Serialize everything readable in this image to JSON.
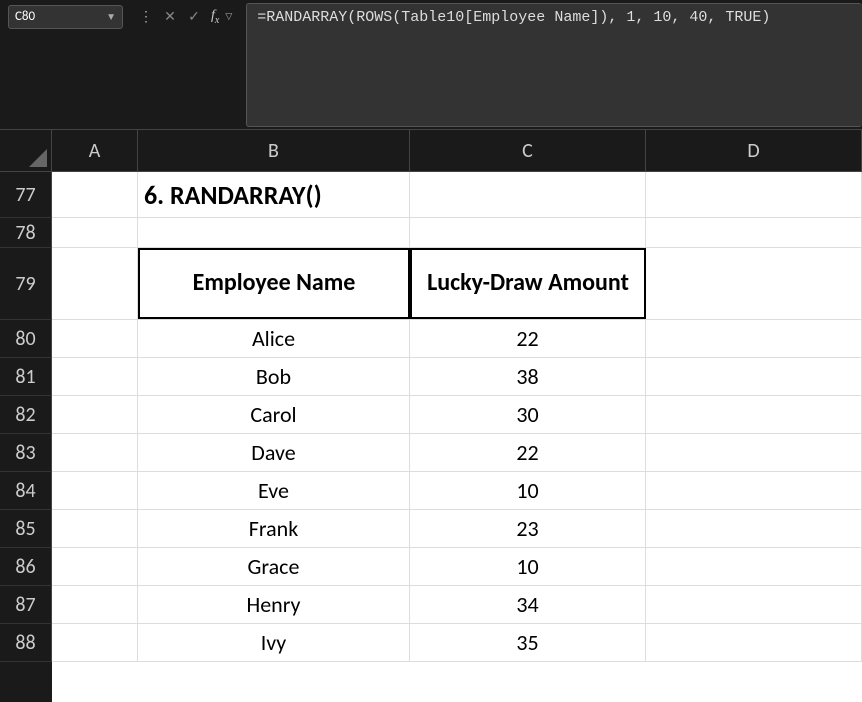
{
  "nameBox": {
    "value": "C80"
  },
  "formulaBar": {
    "formula": "=RANDARRAY(ROWS(Table10[Employee Name]), 1, 10, 40, TRUE)"
  },
  "columns": [
    "A",
    "B",
    "C",
    "D"
  ],
  "rows": [
    "77",
    "78",
    "79",
    "80",
    "81",
    "82",
    "83",
    "84",
    "85",
    "86",
    "87",
    "88"
  ],
  "title": "6. RANDARRAY()",
  "tableHeaders": {
    "employeeName": "Employee Name",
    "luckyDraw": "Lucky-Draw Amount"
  },
  "tableData": [
    {
      "name": "Alice",
      "amount": "22"
    },
    {
      "name": "Bob",
      "amount": "38"
    },
    {
      "name": "Carol",
      "amount": "30"
    },
    {
      "name": "Dave",
      "amount": "22"
    },
    {
      "name": "Eve",
      "amount": "10"
    },
    {
      "name": "Frank",
      "amount": "23"
    },
    {
      "name": "Grace",
      "amount": "10"
    },
    {
      "name": "Henry",
      "amount": "34"
    },
    {
      "name": "Ivy",
      "amount": "35"
    }
  ]
}
